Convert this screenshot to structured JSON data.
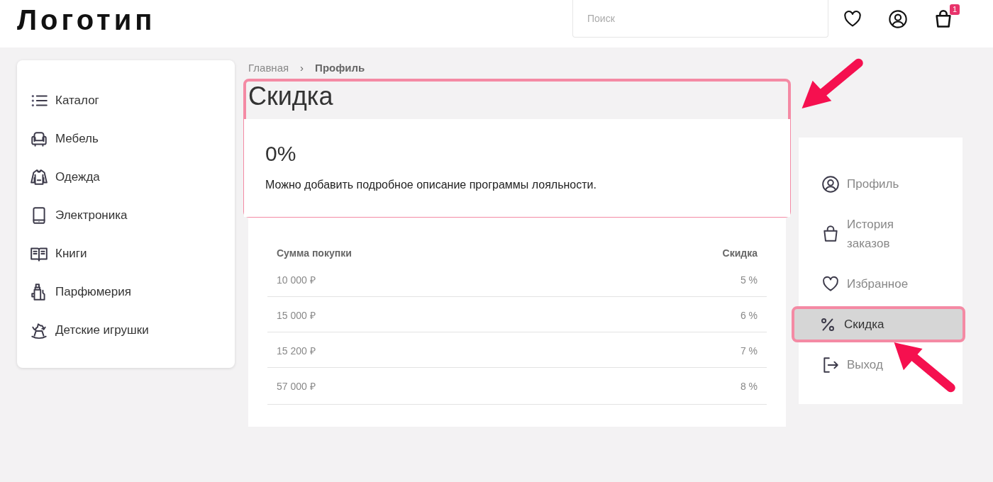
{
  "header": {
    "logo": "Логотип",
    "search": {
      "placeholder": "Поиск"
    },
    "cart_badge": "1"
  },
  "catalog": [
    {
      "label": "Каталог",
      "kind": "list"
    },
    {
      "label": "Мебель",
      "kind": "armchair"
    },
    {
      "label": "Одежда",
      "kind": "hoodie"
    },
    {
      "label": "Электроника",
      "kind": "tablet"
    },
    {
      "label": "Книги",
      "kind": "book"
    },
    {
      "label": "Парфюмерия",
      "kind": "bottles"
    },
    {
      "label": "Детские игрушки",
      "kind": "horse"
    }
  ],
  "breadcrumbs": [
    {
      "label": "Главная",
      "current": false
    },
    {
      "label": "Профиль",
      "current": true
    }
  ],
  "breadcrumb_separator": "›",
  "discount": {
    "title": "Скидка",
    "value": "0%",
    "description": "Можно добавить подробное описание программы лояльности.",
    "highlighted": true
  },
  "table": {
    "columns": [
      "Сумма покупки",
      "Скидка"
    ],
    "rows": [
      [
        "10 000 ₽",
        "5 %"
      ],
      [
        "15 000 ₽",
        "6 %"
      ],
      [
        "15 200 ₽",
        "7 %"
      ],
      [
        "57 000 ₽",
        "8 %"
      ]
    ]
  },
  "profile_nav": [
    {
      "label": "Профиль",
      "kind": "user",
      "selected": false,
      "highlighted": false
    },
    {
      "label": "История заказов",
      "kind": "bag",
      "selected": false,
      "highlighted": false
    },
    {
      "label": "Избранное",
      "kind": "heart",
      "selected": false,
      "highlighted": false
    },
    {
      "label": "Скидка",
      "kind": "percent",
      "selected": true,
      "highlighted": true
    },
    {
      "label": "Выход",
      "kind": "logout",
      "selected": false,
      "highlighted": false
    }
  ],
  "annotations": [
    {
      "kind": "arrow"
    },
    {
      "kind": "arrow"
    }
  ]
}
